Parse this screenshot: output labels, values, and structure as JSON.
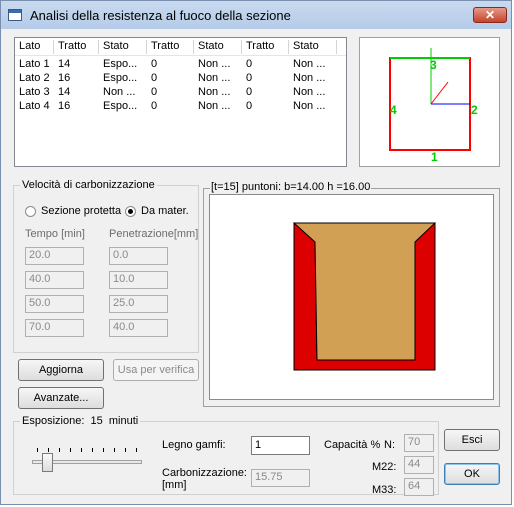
{
  "window": {
    "title": "Analisi della resistenza al fuoco della sezione",
    "close_label": "✕"
  },
  "table": {
    "columns": [
      "Lato",
      "Tratto",
      "Stato",
      "Tratto",
      "Stato",
      "Tratto",
      "Stato"
    ],
    "rows": [
      [
        "Lato 1",
        "14",
        "Espo...",
        "0",
        "Non ...",
        "0",
        "Non ..."
      ],
      [
        "Lato 2",
        "16",
        "Espo...",
        "0",
        "Non ...",
        "0",
        "Non ..."
      ],
      [
        "Lato 3",
        "14",
        "Non ...",
        "0",
        "Non ...",
        "0",
        "Non ..."
      ],
      [
        "Lato 4",
        "16",
        "Espo...",
        "0",
        "Non ...",
        "0",
        "Non ..."
      ]
    ]
  },
  "preview": {
    "side_labels": [
      "1",
      "2",
      "3",
      "4"
    ],
    "colors": {
      "side_exposed": "#ff0000",
      "side_protected": "#00cc00",
      "axis": "#0000ff",
      "labels": "#00cc00"
    }
  },
  "charring": {
    "group_title": "Velocità di carbonizzazione",
    "radio_protected": "Sezione protetta",
    "radio_material": "Da mater.",
    "selected": "Da mater.",
    "col_time": "Tempo [min]",
    "col_penetration": "Penetrazione[mm]",
    "rows": [
      {
        "time": "20.0",
        "penetration": "0.0"
      },
      {
        "time": "40.0",
        "penetration": "10.0"
      },
      {
        "time": "50.0",
        "penetration": "25.0"
      },
      {
        "time": "70.0",
        "penetration": "40.0"
      }
    ]
  },
  "section_view": {
    "caption": "[t=15] puntoni: b=14.00 h =16.00",
    "colors": {
      "residual": "#d2a055",
      "charred": "#dd0000"
    }
  },
  "buttons": {
    "update": "Aggiorna",
    "use_for_check": "Usa per verifica",
    "advanced": "Avanzate...",
    "exit": "Esci",
    "ok": "OK"
  },
  "exposure": {
    "label": "Esposizione:",
    "value": "15",
    "unit": "minuti",
    "slider_value_minutes": 15
  },
  "results": {
    "legno_label": "Legno gamfi:",
    "legno_value": "1",
    "carbon_label_line1": "Carbonizzazione:",
    "carbon_label_line2": "[mm]",
    "carbon_value": "15.75",
    "capacity_label": "Capacità %",
    "n_label": "N:",
    "n_value": "70",
    "m22_label": "M22:",
    "m22_value": "44",
    "m33_label": "M33:",
    "m33_value": "64"
  }
}
